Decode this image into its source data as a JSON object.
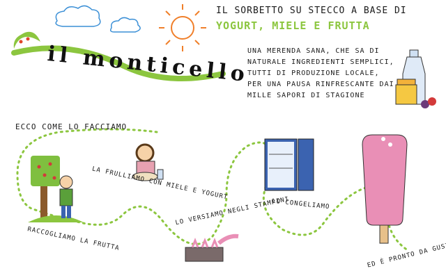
{
  "brand": {
    "title": "il monticello"
  },
  "headline": {
    "line1": "il sorbetto su stecco a base di",
    "line2": "yogurt, miele  e frutta"
  },
  "description": "Una merenda sana, che sa di naturale ingredienti semplici, tutti di produzione locale, per una pausa rinfrescante dai mille sapori di stagione",
  "process": {
    "intro": "Ecco come lo facciamo",
    "steps": [
      {
        "label": "Raccogliamo la frutta"
      },
      {
        "label": "La frulliamo con miele e yogurt"
      },
      {
        "label": "Lo versiamo negli stampini"
      },
      {
        "label": "Lo congeliamo"
      },
      {
        "label": "Ed è pronto da gustare!!"
      }
    ]
  },
  "colors": {
    "accent_green": "#8cc63f",
    "sun_orange": "#f07f2a",
    "cloud_blue": "#3a8fd6",
    "popsicle_pink": "#e98fb6",
    "freezer_blue": "#3b63b0"
  },
  "icons": [
    "cloud-icon",
    "sun-icon",
    "hill-logo-icon",
    "bottle-icon",
    "honey-jar-icon",
    "tree-icon",
    "child-icon",
    "cook-icon",
    "mold-icon",
    "freezer-icon",
    "popsicle-icon"
  ]
}
